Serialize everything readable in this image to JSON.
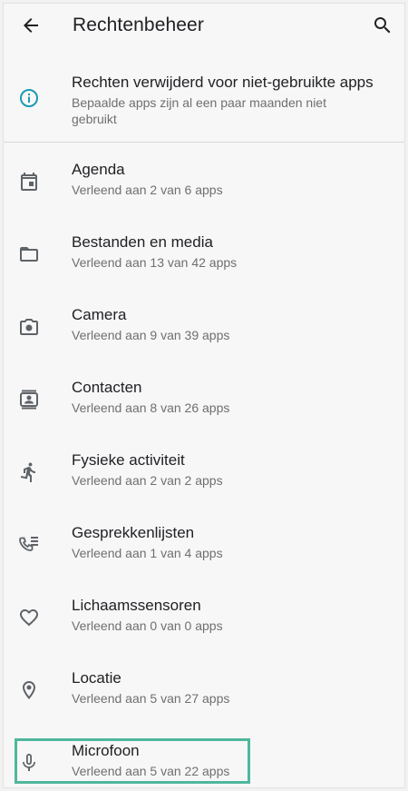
{
  "colors": {
    "accent": "#1a9bb3",
    "highlight_box": "#4fb79c",
    "icon": "#5f6368"
  },
  "appbar": {
    "back_icon": "arrow-left-icon",
    "title": "Rechtenbeheer",
    "search_icon": "search-icon"
  },
  "info_banner": {
    "icon": "info-icon",
    "title": "Rechten verwijderd voor niet-gebruikte apps",
    "subtitle": "Bepaalde apps zijn al een paar maanden niet gebruikt"
  },
  "permissions": [
    {
      "icon": "calendar-icon",
      "label": "Agenda",
      "summary": "Verleend aan 2 van 6 apps"
    },
    {
      "icon": "folder-icon",
      "label": "Bestanden en media",
      "summary": "Verleend aan 13 van 42 apps"
    },
    {
      "icon": "camera-icon",
      "label": "Camera",
      "summary": "Verleend aan 9 van 39 apps"
    },
    {
      "icon": "contacts-icon",
      "label": "Contacten",
      "summary": "Verleend aan 8 van 26 apps"
    },
    {
      "icon": "running-person-icon",
      "label": "Fysieke activiteit",
      "summary": "Verleend aan 2 van 2 apps"
    },
    {
      "icon": "call-log-icon",
      "label": "Gesprekkenlijsten",
      "summary": "Verleend aan 1 van 4 apps"
    },
    {
      "icon": "heart-icon",
      "label": "Lichaamssensoren",
      "summary": "Verleend aan 0 van 0 apps"
    },
    {
      "icon": "location-pin-icon",
      "label": "Locatie",
      "summary": "Verleend aan 5 van 27 apps"
    },
    {
      "icon": "microphone-icon",
      "label": "Microfoon",
      "summary": "Verleend aan 5 van 22 apps"
    }
  ]
}
